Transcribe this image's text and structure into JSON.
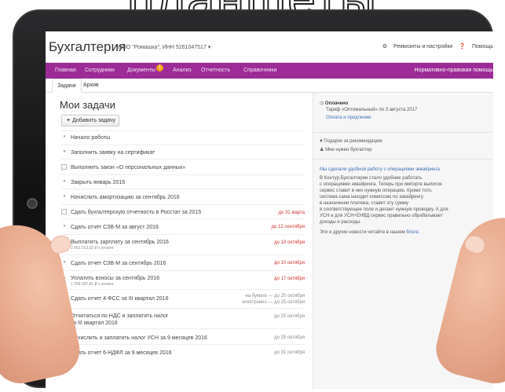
{
  "caption": "планшеты",
  "app": {
    "logo": "Бухгалтерия",
    "org": "ООО \"Ромашка\", ИНН 5261047517 ▾",
    "settings": "Реквизиты и настройки",
    "help": "Помощь"
  },
  "nav": {
    "items": [
      "Главная",
      "Сотрудники",
      "Документы",
      "Анализ",
      "Отчетность",
      "Справочники"
    ],
    "badge": "1",
    "right": "Нормативно-правовая помощь"
  },
  "subtabs": [
    "Задачи",
    "Архив"
  ],
  "main": {
    "title": "Мои задачи",
    "add_button": "Добавить задачу"
  },
  "tasks": [
    {
      "title": "Начало работы",
      "type": "dot"
    },
    {
      "title": "Заполнить заявку на сертификат",
      "type": "dot"
    },
    {
      "title": "Выполнить закон «О персональных данных»",
      "type": "box"
    },
    {
      "title": "Закрыть январь 2016",
      "type": "dot"
    },
    {
      "title": "Начислить амортизацию за сентябрь 2016",
      "type": "dot"
    },
    {
      "title": "Сдать бухгалтерскую отчетность в Росстат за 2015",
      "type": "box",
      "due": "до 31 марта",
      "due_color": "red"
    },
    {
      "title": "Сдать отчет СЗВ-М за август 2016",
      "type": "dot",
      "due": "до 12 сентября",
      "due_color": "red"
    },
    {
      "title": "Выплатить зарплату за сентябрь 2016",
      "sub": "2 061 013,03 ₽ к уплате",
      "type": "dot",
      "due": "до 10 октября",
      "due_color": "red"
    },
    {
      "title": "Сдать отчет СЗВ-М за сентябрь 2016",
      "type": "dot",
      "due": "до 10 октября",
      "due_color": "red"
    },
    {
      "title": "Уплатить взносы за сентябрь 2016",
      "sub": "1 258 397,81 ₽ к уплате",
      "type": "dot",
      "due": "до 17 октября",
      "due_color": "red"
    },
    {
      "title": "Сдать отчет 4-ФСС за III квартал 2016",
      "type": "dot",
      "due": "на бумаге — до 20 октября",
      "due2": "электронно — до 25 октября",
      "due_color": "grey"
    },
    {
      "title": "Отчитаться по НДС и заплатить налог",
      "title2": "за III квартал 2016",
      "type": "dot",
      "due": "до 25 октября",
      "due_color": "grey"
    },
    {
      "title": "Начислить и заплатить налог УСН за 9 месяцев 2016",
      "type": "dot",
      "due": "до 25 октября",
      "due_color": "grey"
    },
    {
      "title": "Сдать отчет 6-НДФЛ за 9 месяцев 2016",
      "type": "dot",
      "due": "до 31 октября",
      "due_color": "grey"
    }
  ],
  "side": {
    "paid_title": "Оплачено",
    "paid_text": "Тариф «Оптимальный» по 3 августа 2017",
    "paid_link": "Оплата и продление",
    "gift": "Подарок за рекомендацию",
    "accountant": "Мне нужен бухгалтер",
    "news_link": "Мы сделали удобной работу с операциями эквайринга",
    "news_lines": [
      "В Контур.Бухгалтерии стало удобнее работать",
      "с операциями эквайринга. Теперь при импорте выписок",
      "сервис ставит в них нужную операцию. Кроме того,",
      "система сама находит комиссию по эквайрингу",
      "в назначении платежа, ставит эту сумму",
      "в соответствующее поле и делает нужную проводку. А для",
      "УСН и для УСН+ЕНВД сервис правильно обрабатывает",
      "доходы и расходы."
    ],
    "more_text": "Эти и другие новости читайте в нашем",
    "more_link": "блоге."
  }
}
